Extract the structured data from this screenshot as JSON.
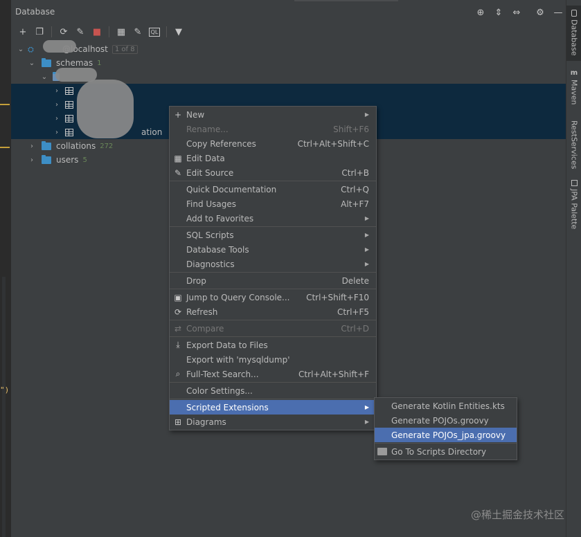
{
  "panel": {
    "title": "Database"
  },
  "header_actions": [
    {
      "name": "target-icon",
      "glyph": "⊕"
    },
    {
      "name": "expand-all-icon",
      "glyph": "⇕"
    },
    {
      "name": "collapse-all-icon",
      "glyph": "⇔"
    },
    {
      "name": "gear-icon",
      "glyph": "⚙"
    },
    {
      "name": "minimize-icon",
      "glyph": "—"
    }
  ],
  "toolbar": [
    {
      "name": "add-icon",
      "glyph": "+"
    },
    {
      "name": "duplicate-icon",
      "glyph": "❐"
    },
    {
      "name": "refresh-icon",
      "glyph": "⟳"
    },
    {
      "name": "schema-edit-icon",
      "glyph": "✎"
    },
    {
      "name": "stop-icon",
      "glyph": "■",
      "color": "#c75450"
    },
    {
      "name": "table-view-icon",
      "glyph": "▦"
    },
    {
      "name": "edit-icon",
      "glyph": "✎"
    },
    {
      "name": "query-console-icon",
      "glyph": "QL"
    },
    {
      "name": "filter-icon",
      "glyph": "▼"
    }
  ],
  "tree": {
    "connection": {
      "label": "@localhost",
      "badge": "1 of 8"
    },
    "schemas": {
      "label": "schemas",
      "count": "1"
    },
    "tables": [
      {
        "label": ""
      },
      {
        "label": ""
      },
      {
        "label": ""
      },
      {
        "label": "ation"
      }
    ],
    "collations": {
      "label": "collations",
      "count": "272"
    },
    "users": {
      "label": "users",
      "count": "5"
    }
  },
  "context_menu": [
    {
      "type": "item",
      "icon": "plus-icon",
      "glyph": "+",
      "label": "New",
      "shortcut": "",
      "submenu": true
    },
    {
      "type": "item",
      "label": "Rename...",
      "shortcut": "Shift+F6",
      "disabled": true
    },
    {
      "type": "item",
      "label": "Copy References",
      "shortcut": "Ctrl+Alt+Shift+C"
    },
    {
      "type": "item",
      "icon": "table-icon",
      "glyph": "▦",
      "label": "Edit Data",
      "shortcut": ""
    },
    {
      "type": "item",
      "icon": "pencil-icon",
      "glyph": "✎",
      "label": "Edit Source",
      "shortcut": "Ctrl+B"
    },
    {
      "type": "sep"
    },
    {
      "type": "item",
      "label": "Quick Documentation",
      "shortcut": "Ctrl+Q"
    },
    {
      "type": "item",
      "label": "Find Usages",
      "shortcut": "Alt+F7"
    },
    {
      "type": "item",
      "label": "Add to Favorites",
      "shortcut": "",
      "submenu": true
    },
    {
      "type": "sep"
    },
    {
      "type": "item",
      "label": "SQL Scripts",
      "shortcut": "",
      "submenu": true
    },
    {
      "type": "item",
      "label": "Database Tools",
      "shortcut": "",
      "submenu": true
    },
    {
      "type": "item",
      "label": "Diagnostics",
      "shortcut": "",
      "submenu": true
    },
    {
      "type": "sep"
    },
    {
      "type": "item",
      "label": "Drop",
      "shortcut": "Delete"
    },
    {
      "type": "sep"
    },
    {
      "type": "item",
      "icon": "query-console-icon",
      "glyph": "▣",
      "label": "Jump to Query Console...",
      "shortcut": "Ctrl+Shift+F10"
    },
    {
      "type": "item",
      "icon": "refresh-icon",
      "glyph": "⟳",
      "label": "Refresh",
      "shortcut": "Ctrl+F5"
    },
    {
      "type": "sep"
    },
    {
      "type": "item",
      "icon": "compare-icon",
      "glyph": "⇄",
      "label": "Compare",
      "shortcut": "Ctrl+D",
      "disabled": true
    },
    {
      "type": "sep"
    },
    {
      "type": "item",
      "icon": "download-icon",
      "glyph": "⤓",
      "label": "Export Data to Files",
      "shortcut": ""
    },
    {
      "type": "item",
      "label": "Export with 'mysqldump'",
      "shortcut": ""
    },
    {
      "type": "item",
      "icon": "search-icon",
      "glyph": "⌕",
      "label": "Full-Text Search...",
      "shortcut": "Ctrl+Alt+Shift+F"
    },
    {
      "type": "sep"
    },
    {
      "type": "item",
      "label": "Color Settings...",
      "shortcut": ""
    },
    {
      "type": "sep"
    },
    {
      "type": "item",
      "label": "Scripted Extensions",
      "shortcut": "",
      "submenu": true,
      "highlight": true
    },
    {
      "type": "item",
      "icon": "diagram-icon",
      "glyph": "⊞",
      "label": "Diagrams",
      "shortcut": "",
      "submenu": true
    }
  ],
  "submenu": [
    {
      "label": "Generate Kotlin Entities.kts"
    },
    {
      "label": "Generate POJOs.groovy"
    },
    {
      "label": "Generate POJOs_jpa.groovy",
      "highlight": true
    },
    {
      "type": "sep"
    },
    {
      "label": "Go To Scripts Directory",
      "icon": "folder-icon"
    }
  ],
  "right_tabs": [
    {
      "name": "database",
      "label": "Database",
      "active": true
    },
    {
      "name": "maven",
      "label": "Maven"
    },
    {
      "name": "restservices",
      "label": "RestServices"
    },
    {
      "name": "jpa-palette",
      "label": "JPA Palette"
    }
  ],
  "watermark": "@稀土掘金技术社区",
  "colors": {
    "selection": "#0d293e",
    "highlight": "#4b6eaf",
    "folder": "#3d8ec5",
    "count": "#6a8759"
  }
}
